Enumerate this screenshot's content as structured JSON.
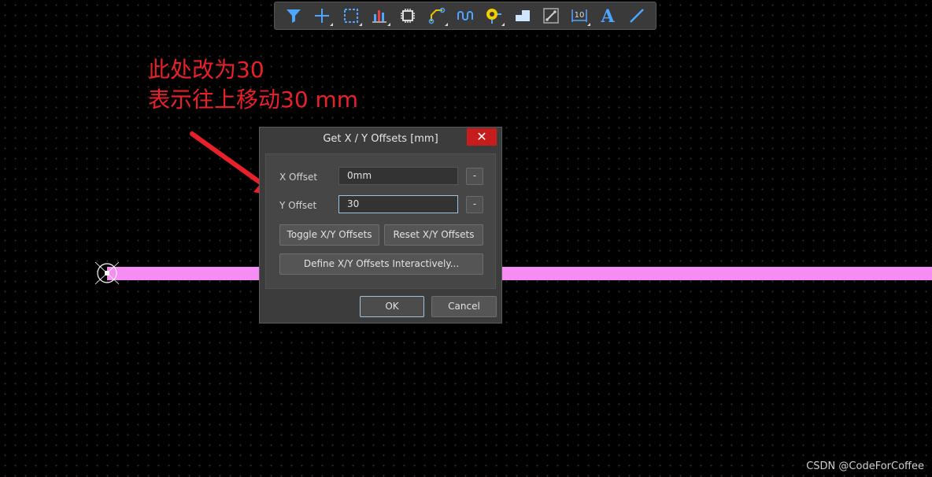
{
  "toolbar": {
    "items": [
      {
        "icon": "filter-icon"
      },
      {
        "icon": "crosshair-plus-icon"
      },
      {
        "icon": "select-rectangle-icon"
      },
      {
        "icon": "bar-chart-icon"
      },
      {
        "icon": "component-chip-icon"
      },
      {
        "icon": "route-icon"
      },
      {
        "icon": "interactive-routing-icon"
      },
      {
        "icon": "via-pad-icon"
      },
      {
        "icon": "polygon-fill-icon"
      },
      {
        "icon": "keepout-icon"
      },
      {
        "icon": "dimension-icon"
      },
      {
        "icon": "string-icon"
      },
      {
        "icon": "line-icon"
      }
    ],
    "string_glyph": "A",
    "dimension_glyph": "10"
  },
  "annotation": {
    "line1": "此处改为30",
    "line2": "表示往上移动30 mm"
  },
  "dialog": {
    "title": "Get X / Y Offsets [mm]",
    "close_label": "✕",
    "x_label": "X Offset",
    "x_value": "0mm",
    "y_label": "Y Offset",
    "y_value": "30",
    "mini_label": "-",
    "toggle_label": "Toggle X/Y Offsets",
    "reset_label": "Reset X/Y Offsets",
    "define_label": "Define X/Y Offsets Interactively...",
    "ok_label": "OK",
    "cancel_label": "Cancel"
  },
  "watermark": "CSDN @CodeForCoffee",
  "colors": {
    "track": "#f58df5",
    "annotation": "#e8202a",
    "toolbar_icon": "#4da6ff",
    "via_icon": "#f0d000",
    "close_button": "#c61c1c"
  }
}
